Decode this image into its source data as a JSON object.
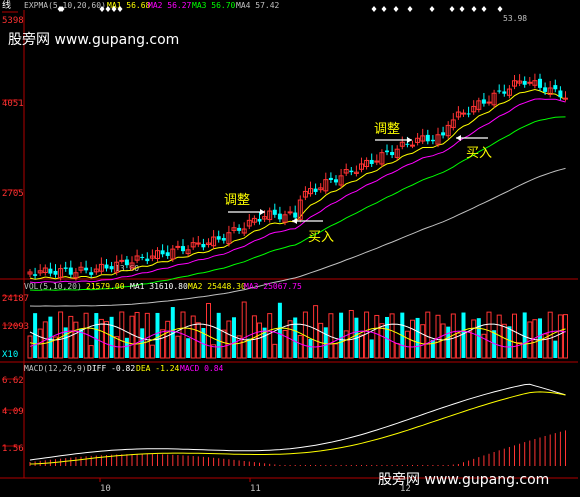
{
  "header": {
    "tag": "线",
    "ma_label": "EXPMA(5,10,20,60)",
    "ma_items": [
      {
        "text": "MA1 56.68",
        "color": "#ffff00"
      },
      {
        "text": "MA2 56.27",
        "color": "#ff00ff"
      },
      {
        "text": "MA3 56.70",
        "color": "#00ff00"
      },
      {
        "text": "MA4 57.42",
        "color": "#c0c0c0"
      }
    ]
  },
  "watermark": "股旁网 www.gupang.com",
  "price": {
    "ticks": [
      "5398",
      "4051",
      "2705"
    ],
    "high_label": "53.98",
    "low_label": "13.60",
    "annotations": [
      {
        "text": "调整",
        "color": "#ffff00"
      },
      {
        "text": "买入",
        "color": "#ffff00"
      },
      {
        "text": "调整",
        "color": "#ffff00"
      },
      {
        "text": "买入",
        "color": "#ffff00"
      }
    ]
  },
  "volume": {
    "label": "VOL(5,10,20)",
    "items": [
      {
        "text": "21579.00",
        "color": "#ffff00"
      },
      {
        "text": "MA1 31610.80",
        "color": "#ffffff"
      },
      {
        "text": "MA2 25448.30",
        "color": "#ffff00"
      },
      {
        "text": "MA3 25067.75",
        "color": "#ff00ff"
      }
    ],
    "ticks": [
      "24187",
      "12093"
    ],
    "unit": "X10"
  },
  "macd": {
    "label": "MACD(12,26,9)",
    "items": [
      {
        "text": "DIFF -0.82",
        "color": "#ffffff"
      },
      {
        "text": "DEA -1.24",
        "color": "#ffff00"
      },
      {
        "text": "MACD 0.84",
        "color": "#ff00ff"
      }
    ],
    "ticks": [
      "6.62",
      "4.09",
      "1.56"
    ]
  },
  "xaxis": {
    "ticks": [
      "10",
      "11",
      "12"
    ]
  },
  "chart_data": {
    "type": "line",
    "price_ticks": [
      5398,
      4051,
      2705
    ],
    "price_high": 53.98,
    "price_low": 13.6,
    "volume_ticks": [
      24187,
      12093
    ],
    "macd_ticks": [
      6.62,
      4.09,
      1.56
    ],
    "x_ticks": [
      "10",
      "11",
      "12"
    ],
    "series": [
      {
        "name": "MA1",
        "values": [
          56.68
        ]
      },
      {
        "name": "MA2",
        "values": [
          56.27
        ]
      },
      {
        "name": "MA3",
        "values": [
          56.7
        ]
      },
      {
        "name": "MA4",
        "values": [
          57.42
        ]
      }
    ],
    "volume_series": [
      {
        "name": "VOL",
        "values": [
          21579.0
        ]
      },
      {
        "name": "MA1",
        "values": [
          31610.8
        ]
      },
      {
        "name": "MA2",
        "values": [
          25448.3
        ]
      },
      {
        "name": "MA3",
        "values": [
          25067.75
        ]
      }
    ],
    "macd_series": [
      {
        "name": "DIFF",
        "values": [
          -0.82
        ]
      },
      {
        "name": "DEA",
        "values": [
          -1.24
        ]
      },
      {
        "name": "MACD",
        "values": [
          0.84
        ]
      }
    ]
  }
}
